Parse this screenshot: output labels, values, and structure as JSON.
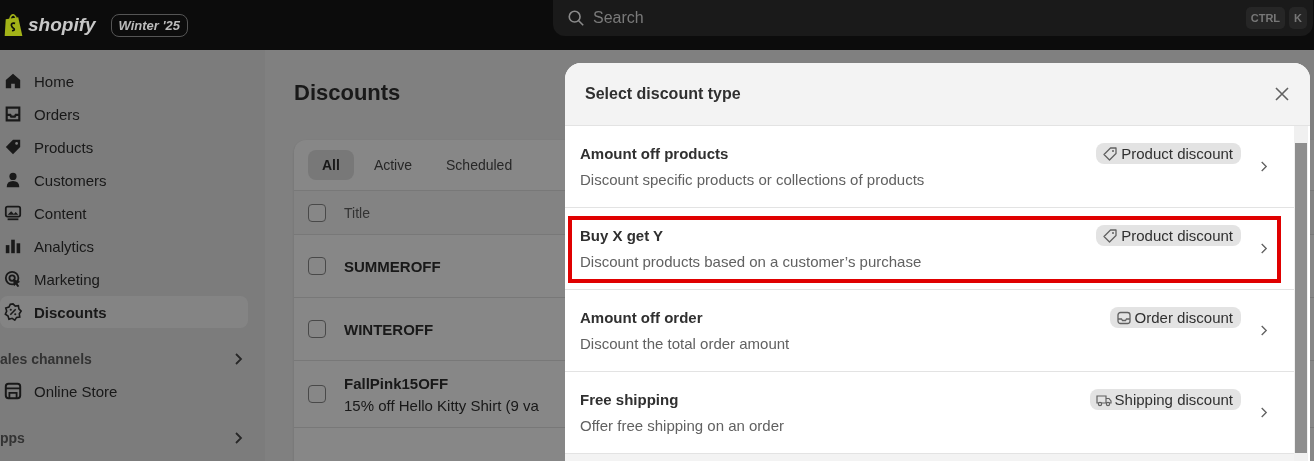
{
  "topbar": {
    "brand": "shopify",
    "version_badge": "Winter '25",
    "search": {
      "placeholder": "Search"
    },
    "shortcut_keys": [
      "CTRL",
      "K"
    ]
  },
  "sidebar": {
    "items": [
      {
        "label": "Home",
        "kind": "home",
        "selected": false
      },
      {
        "label": "Orders",
        "kind": "inbox",
        "selected": false
      },
      {
        "label": "Products",
        "kind": "tag",
        "selected": false
      },
      {
        "label": "Customers",
        "kind": "person",
        "selected": false
      },
      {
        "label": "Content",
        "kind": "image",
        "selected": false
      },
      {
        "label": "Analytics",
        "kind": "bars",
        "selected": false
      },
      {
        "label": "Marketing",
        "kind": "target",
        "selected": false
      },
      {
        "label": "Discounts",
        "kind": "percent",
        "selected": true
      }
    ],
    "sections": [
      {
        "label": "ales channels",
        "items": [
          {
            "label": "Online Store",
            "kind": "store"
          }
        ]
      },
      {
        "label": "pps"
      }
    ]
  },
  "page": {
    "title": "Discounts",
    "tabs": [
      {
        "label": "All",
        "selected": true
      },
      {
        "label": "Active",
        "selected": false
      },
      {
        "label": "Scheduled",
        "selected": false
      }
    ],
    "table": {
      "header": {
        "label": "Title",
        "checked": false
      },
      "rows": [
        {
          "title": "SUMMEROFF",
          "checked": false
        },
        {
          "title": "WINTEROFF",
          "checked": false
        },
        {
          "title": "FallPink15OFF",
          "subtitle": "15% off Hello Kitty Shirt (9 va",
          "checked": false
        }
      ]
    }
  },
  "modal": {
    "title": "Select discount type",
    "options": [
      {
        "title": "Amount off products",
        "description": "Discount specific products or collections of products",
        "badge": {
          "kind": "tag",
          "label": "Product discount"
        },
        "highlighted": false
      },
      {
        "title": "Buy X get Y",
        "description": "Discount products based on a customer’s purchase",
        "badge": {
          "kind": "tag",
          "label": "Product discount"
        },
        "highlighted": true
      },
      {
        "title": "Amount off order",
        "description": "Discount the total order amount",
        "badge": {
          "kind": "inbox",
          "label": "Order discount"
        },
        "highlighted": false
      },
      {
        "title": "Free shipping",
        "description": "Offer free shipping on an order",
        "badge": {
          "kind": "truck",
          "label": "Shipping discount"
        },
        "highlighted": false
      }
    ]
  }
}
